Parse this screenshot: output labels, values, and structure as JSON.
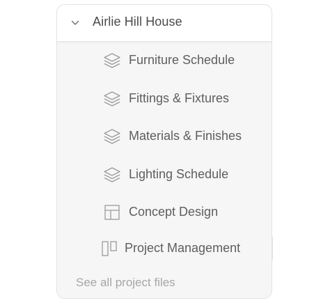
{
  "project": {
    "title": "Airlie Hill House",
    "expanded_icon": "chevron-down-icon"
  },
  "items": [
    {
      "label": "Furniture Schedule",
      "icon": "layers-icon"
    },
    {
      "label": "Fittings & Fixtures",
      "icon": "layers-icon"
    },
    {
      "label": "Materials & Finishes",
      "icon": "layers-icon"
    },
    {
      "label": "Lighting Schedule",
      "icon": "layers-icon"
    },
    {
      "label": "Concept Design",
      "icon": "layout-icon"
    },
    {
      "label": "Project Management",
      "icon": "kanban-icon"
    }
  ],
  "footer": {
    "link": "See all project files"
  },
  "colors": {
    "panel_bg": "#f6f6f6",
    "header_bg": "#ffffff",
    "text": "#5e5e5e",
    "muted": "#a6a6a6",
    "icon": "#9a9a9a"
  }
}
